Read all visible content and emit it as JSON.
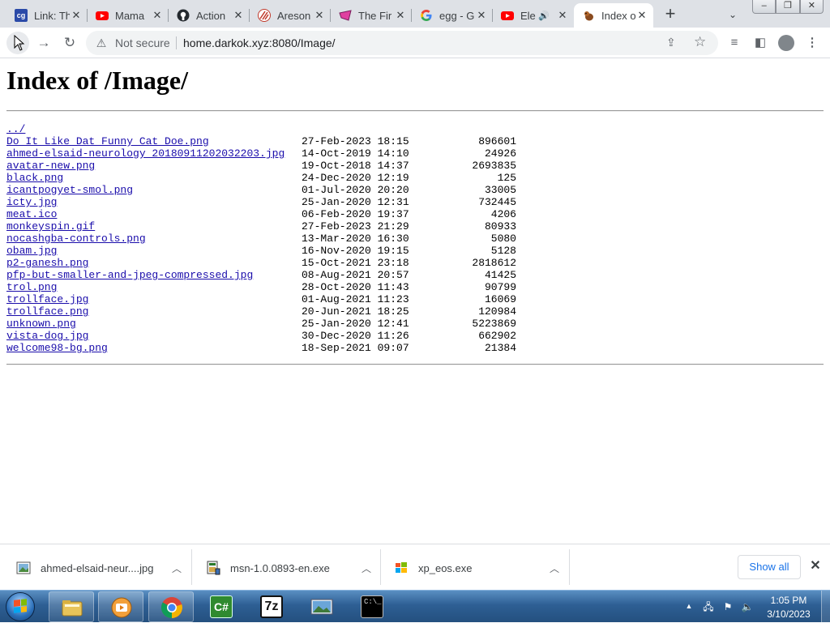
{
  "tabs": [
    {
      "title": "Link: Th",
      "icon": "cg-logo-icon"
    },
    {
      "title": "Mama",
      "icon": "youtube-icon"
    },
    {
      "title": "Action",
      "icon": "github-icon"
    },
    {
      "title": "Areson",
      "icon": "aresona-icon"
    },
    {
      "title": "The Fir",
      "icon": "pink-shape-icon"
    },
    {
      "title": "egg - G",
      "icon": "google-icon"
    },
    {
      "title": "Ele",
      "icon": "youtube-icon"
    },
    {
      "title": "Index o",
      "icon": "squirrel-icon",
      "active": true
    }
  ],
  "toolbar": {
    "security_label": "Not secure",
    "url": "home.darkok.xyz:8080/Image/"
  },
  "page": {
    "heading": "Index of /Image/",
    "parent_link": "../",
    "files": [
      {
        "name": "Do It Like Dat Funny Cat Doe.png",
        "date": "27-Feb-2023 18:15",
        "size": "896601"
      },
      {
        "name": "ahmed-elsaid-neurology_20180911202032203.jpg",
        "date": "14-Oct-2019 14:10",
        "size": "24926"
      },
      {
        "name": "avatar-new.png",
        "date": "19-Oct-2018 14:37",
        "size": "2693835"
      },
      {
        "name": "black.png",
        "date": "24-Dec-2020 12:19",
        "size": "125"
      },
      {
        "name": "icantpogyet-smol.png",
        "date": "01-Jul-2020 20:20",
        "size": "33005"
      },
      {
        "name": "icty.jpg",
        "date": "25-Jan-2020 12:31",
        "size": "732445"
      },
      {
        "name": "meat.ico",
        "date": "06-Feb-2020 19:37",
        "size": "4206"
      },
      {
        "name": "monkeyspin.gif",
        "date": "27-Feb-2023 21:29",
        "size": "80933"
      },
      {
        "name": "nocashgba-controls.png",
        "date": "13-Mar-2020 16:30",
        "size": "5080"
      },
      {
        "name": "obam.jpg",
        "date": "16-Nov-2020 19:15",
        "size": "5128"
      },
      {
        "name": "p2-ganesh.png",
        "date": "15-Oct-2021 23:18",
        "size": "2818612"
      },
      {
        "name": "pfp-but-smaller-and-jpeg-compressed.jpg",
        "date": "08-Aug-2021 20:57",
        "size": "41425"
      },
      {
        "name": "trol.png",
        "date": "28-Oct-2020 11:43",
        "size": "90799"
      },
      {
        "name": "trollface.jpg",
        "date": "01-Aug-2021 11:23",
        "size": "16069"
      },
      {
        "name": "trollface.png",
        "date": "20-Jun-2021 18:25",
        "size": "120984"
      },
      {
        "name": "unknown.png",
        "date": "25-Jan-2020 12:41",
        "size": "5223869"
      },
      {
        "name": "vista-dog.jpg",
        "date": "30-Dec-2020 11:26",
        "size": "662902"
      },
      {
        "name": "welcome98-bg.png",
        "date": "18-Sep-2021 09:07",
        "size": "21384"
      }
    ]
  },
  "downloads": {
    "items": [
      {
        "name": "ahmed-elsaid-neur....jpg",
        "icon": "image-file-icon"
      },
      {
        "name": "msn-1.0.0893-en.exe",
        "icon": "installer-icon"
      },
      {
        "name": "xp_eos.exe",
        "icon": "windows-exe-icon"
      }
    ],
    "show_all_label": "Show all"
  },
  "taskbar": {
    "time": "1:05 PM",
    "date": "3/10/2023"
  },
  "colors": {
    "link": "#1a0dab",
    "tabstrip_bg": "#dee1e6",
    "taskbar_top": "#5a8fc2",
    "taskbar_bottom": "#24507f",
    "show_all_text": "#1a73e8"
  }
}
